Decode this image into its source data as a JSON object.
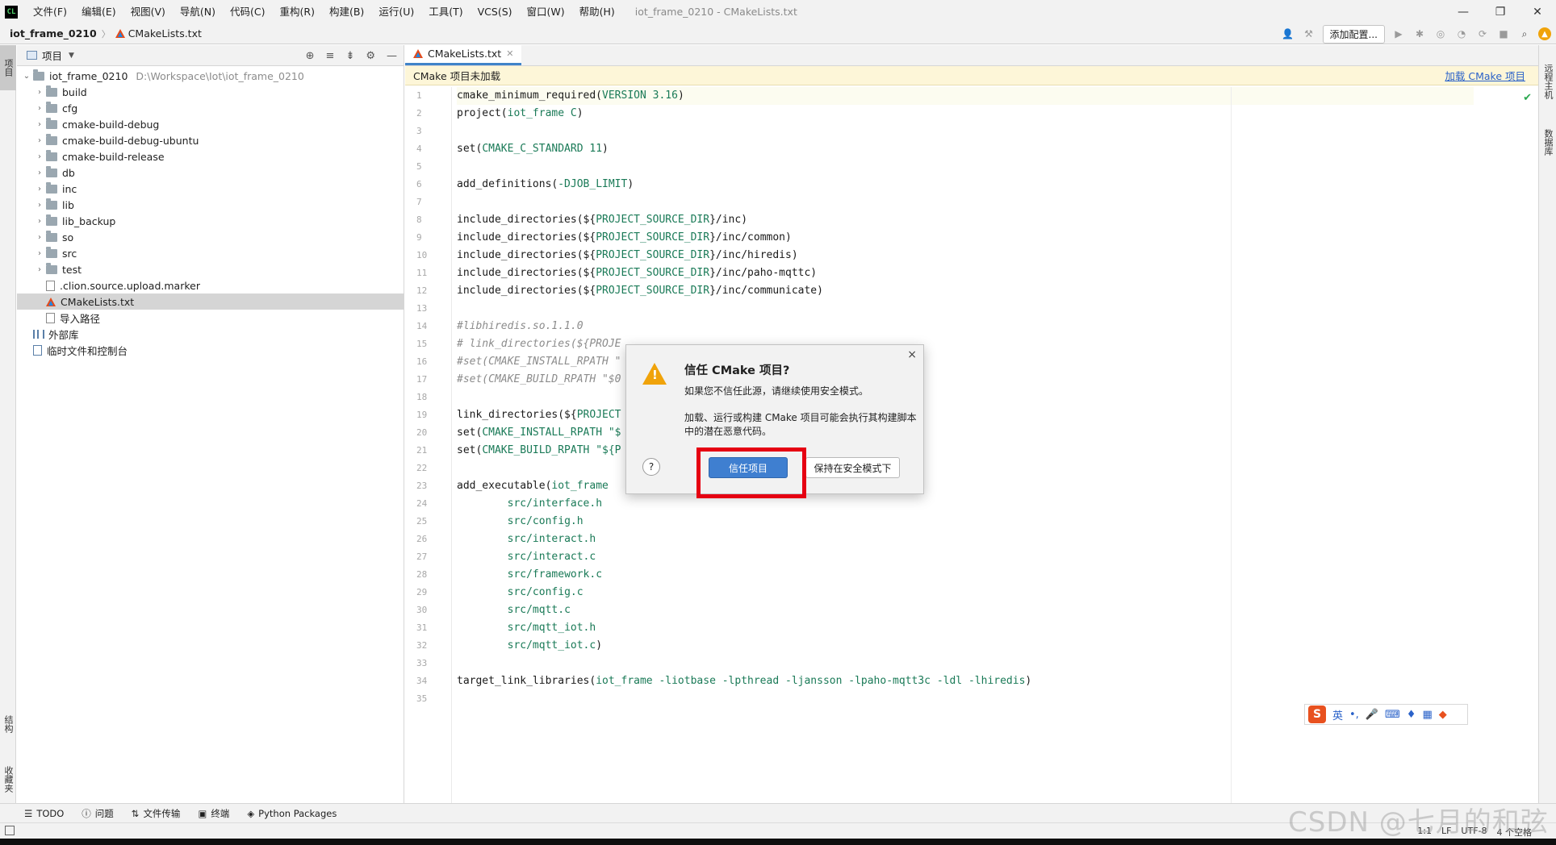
{
  "app": {
    "logo": "CL",
    "menu": [
      "文件(F)",
      "编辑(E)",
      "视图(V)",
      "导航(N)",
      "代码(C)",
      "重构(R)",
      "构建(B)",
      "运行(U)",
      "工具(T)",
      "VCS(S)",
      "窗口(W)",
      "帮助(H)"
    ],
    "window_title": "iot_frame_0210 - CMakeLists.txt"
  },
  "navbar": {
    "project": "iot_frame_0210",
    "file": "CMakeLists.txt",
    "add_config": "添加配置..."
  },
  "left_strip": {
    "project_tab": "项目",
    "structure_tab": "结构",
    "favorites_tab": "收藏夹"
  },
  "right_strip": {
    "remote_tab": "远程主机",
    "db_tab": "数据库"
  },
  "project_panel": {
    "title": "项目",
    "root": {
      "name": "iot_frame_0210",
      "path": "D:\\Workspace\\Iot\\iot_frame_0210"
    },
    "folders": [
      "build",
      "cfg",
      "cmake-build-debug",
      "cmake-build-debug-ubuntu",
      "cmake-build-release",
      "db",
      "inc",
      "lib",
      "lib_backup",
      "so",
      "src",
      "test"
    ],
    "files": [
      ".clion.source.upload.marker",
      "CMakeLists.txt",
      "导入路径"
    ],
    "external_libs": "外部库",
    "scratches": "临时文件和控制台"
  },
  "editor": {
    "tab": "CMakeLists.txt",
    "notification": "CMake 项目未加载",
    "notification_link": "加载 CMake 项目",
    "line_numbers": [
      "1",
      "2",
      "3",
      "4",
      "5",
      "6",
      "7",
      "8",
      "9",
      "10",
      "11",
      "12",
      "13",
      "14",
      "15",
      "16",
      "17",
      "18",
      "19",
      "20",
      "21",
      "22",
      "23",
      "24",
      "25",
      "26",
      "27",
      "28",
      "29",
      "30",
      "31",
      "32",
      "33",
      "34",
      "35"
    ],
    "code": [
      {
        "t": "cmake_minimum_required(",
        "a": "VERSION 3.16",
        "e": ")"
      },
      {
        "t": "project(",
        "a": "iot_frame C",
        "e": ")"
      },
      {
        "t": "",
        "a": "",
        "e": ""
      },
      {
        "t": "set(",
        "a": "CMAKE_C_STANDARD 11",
        "e": ")"
      },
      {
        "t": "",
        "a": "",
        "e": ""
      },
      {
        "t": "add_definitions(",
        "a": "-DJOB_LIMIT",
        "e": ")"
      },
      {
        "t": "",
        "a": "",
        "e": ""
      },
      {
        "t": "include_directories(${",
        "a": "PROJECT_SOURCE_DIR",
        "e": "}/inc)"
      },
      {
        "t": "include_directories(${",
        "a": "PROJECT_SOURCE_DIR",
        "e": "}/inc/common)"
      },
      {
        "t": "include_directories(${",
        "a": "PROJECT_SOURCE_DIR",
        "e": "}/inc/hiredis)"
      },
      {
        "t": "include_directories(${",
        "a": "PROJECT_SOURCE_DIR",
        "e": "}/inc/paho-mqttc)"
      },
      {
        "t": "include_directories(${",
        "a": "PROJECT_SOURCE_DIR",
        "e": "}/inc/communicate)"
      },
      {
        "t": "",
        "a": "",
        "e": ""
      },
      {
        "c": "#libhiredis.so.1.1.0"
      },
      {
        "c": "# link_directories(${PROJE"
      },
      {
        "c": "#set(CMAKE_INSTALL_RPATH \""
      },
      {
        "c": "#set(CMAKE_BUILD_RPATH \"$0"
      },
      {
        "t": "",
        "a": "",
        "e": ""
      },
      {
        "t": "link_directories(${",
        "a": "PROJECT",
        "e": ""
      },
      {
        "t": "set(",
        "a": "CMAKE_INSTALL_RPATH \"$",
        "e": ""
      },
      {
        "t": "set(",
        "a": "CMAKE_BUILD_RPATH \"${P",
        "e": ""
      },
      {
        "t": "",
        "a": "",
        "e": ""
      },
      {
        "t": "add_executable(",
        "a": "iot_frame",
        "e": ""
      },
      {
        "t": "        ",
        "a": "src/interface.h",
        "e": ""
      },
      {
        "t": "        ",
        "a": "src/config.h",
        "e": ""
      },
      {
        "t": "        ",
        "a": "src/interact.h",
        "e": ""
      },
      {
        "t": "        ",
        "a": "src/interact.c",
        "e": ""
      },
      {
        "t": "        ",
        "a": "src/framework.c",
        "e": ""
      },
      {
        "t": "        ",
        "a": "src/config.c",
        "e": ""
      },
      {
        "t": "        ",
        "a": "src/mqtt.c",
        "e": ""
      },
      {
        "t": "        ",
        "a": "src/mqtt_iot.h",
        "e": ""
      },
      {
        "t": "        ",
        "a": "src/mqtt_iot.c",
        "e": ")"
      },
      {
        "t": "",
        "a": "",
        "e": ""
      },
      {
        "t": "target_link_libraries(",
        "a": "iot_frame -liotbase -lpthread -ljansson -lpaho-mqtt3c -ldl -lhiredis",
        "e": ")"
      },
      {
        "t": "",
        "a": "",
        "e": ""
      }
    ]
  },
  "dialog": {
    "title": "信任 CMake 项目?",
    "line1": "如果您不信任此源，请继续使用安全模式。",
    "line2": "加载、运行或构建 CMake 项目可能会执行其构建脚本中的潜在恶意代码。",
    "help": "?",
    "trust_button": "信任项目",
    "safe_button": "保持在安全模式下",
    "close": "×"
  },
  "ime": {
    "logo": "S",
    "lang": "英"
  },
  "bottom_tools": [
    "TODO",
    "问题",
    "文件传输",
    "终端",
    "Python Packages"
  ],
  "status": [
    "1:1",
    "LF",
    "UTF-8",
    "4 个空格"
  ],
  "watermark": "CSDN @七月的和弦",
  "colors": {
    "accent": "#3f7fd0",
    "highlight": "#e60012",
    "notify_bg": "#fdf6d8",
    "warn": "#f0a30a"
  }
}
